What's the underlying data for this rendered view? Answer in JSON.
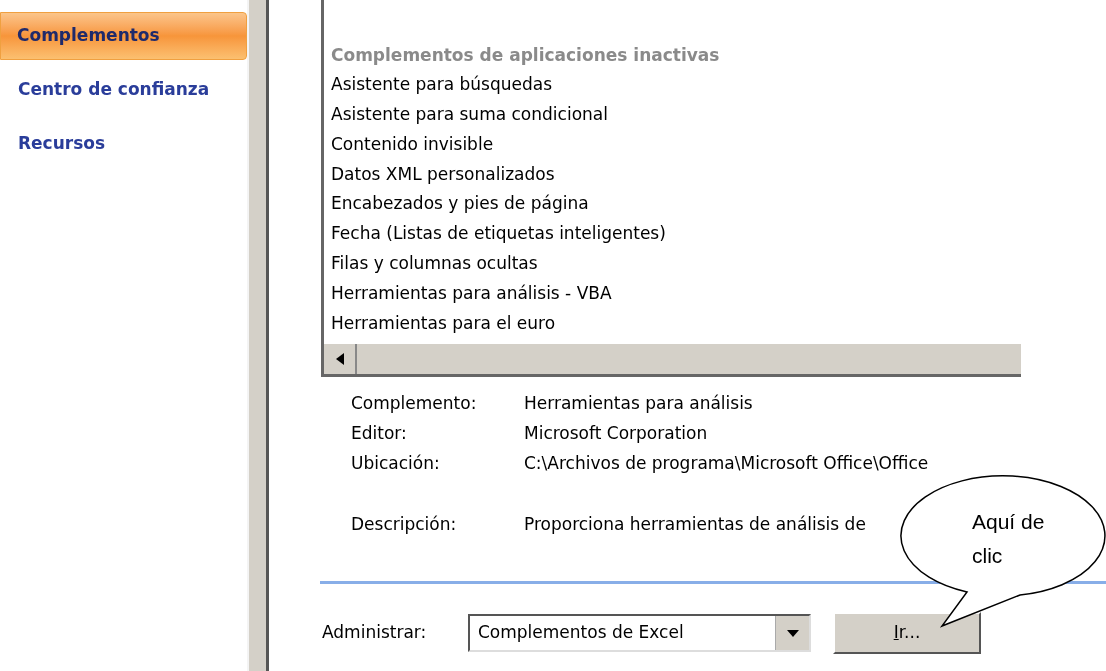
{
  "sidebar": {
    "items": [
      {
        "label": "Complementos",
        "selected": true
      },
      {
        "label": "Centro de confianza",
        "selected": false
      },
      {
        "label": "Recursos",
        "selected": false
      }
    ]
  },
  "addin_list": {
    "group_header": "Complementos de aplicaciones inactivas",
    "rows": [
      "Asistente para búsquedas",
      "Asistente para suma condicional",
      "Contenido invisible",
      "Datos XML personalizados",
      "Encabezados y pies de página",
      "Fecha (Listas de etiquetas inteligentes)",
      "Filas y columnas ocultas",
      "Herramientas para análisis - VBA",
      "Herramientas para el euro"
    ]
  },
  "details": [
    {
      "label": "Complemento:",
      "value": "Herramientas para análisis"
    },
    {
      "label": "Editor:",
      "value": "Microsoft Corporation"
    },
    {
      "label": "Ubicación:",
      "value": "C:\\Archivos de programa\\Microsoft Office\\Office"
    },
    {
      "label": "Descripción:",
      "value": "Proporciona herramientas de análisis de"
    }
  ],
  "manage": {
    "label": "Administrar:",
    "value": "Complementos de Excel",
    "go_button": "Ir..."
  },
  "callout": {
    "text": "Aquí de clic"
  }
}
